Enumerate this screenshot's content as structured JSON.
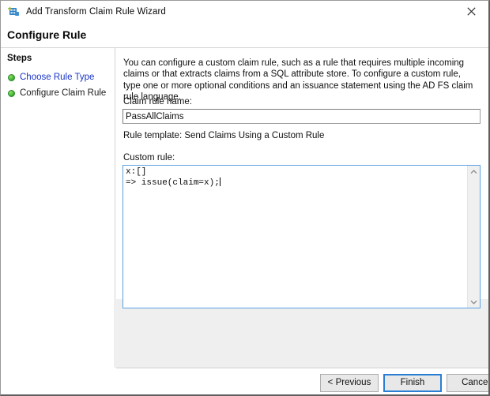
{
  "window": {
    "title": "Add Transform Claim Rule Wizard",
    "app_icon": "adfs-claim-rule-icon",
    "close_icon": "close-icon"
  },
  "header": {
    "title": "Configure Rule"
  },
  "sidebar": {
    "heading": "Steps",
    "items": [
      {
        "label": "Choose Rule Type",
        "state": "completed-link"
      },
      {
        "label": "Configure Claim Rule",
        "state": "current"
      }
    ]
  },
  "main": {
    "description": "You can configure a custom claim rule, such as a rule that requires multiple incoming claims or that extracts claims from a SQL attribute store. To configure a custom rule, type one or more optional conditions and an issuance statement using the AD FS claim rule language.",
    "claim_rule_name_label": "Claim rule name:",
    "claim_rule_name_value": "PassAllClaims",
    "rule_template_text": "Rule template: Send Claims Using a Custom Rule",
    "custom_rule_label": "Custom rule:",
    "custom_rule_value": "x:[]\n=> issue(claim=x);",
    "scrollbar": {
      "up_icon": "chevron-up-icon",
      "down_icon": "chevron-down-icon"
    }
  },
  "footer": {
    "previous_label": "< Previous",
    "finish_label": "Finish",
    "cancel_label": "Cancel"
  },
  "colors": {
    "focus_border": "#2a7fd4",
    "link_text": "#1a34c8",
    "step_bullet": "#45b83a",
    "panel_gray": "#efefef"
  }
}
